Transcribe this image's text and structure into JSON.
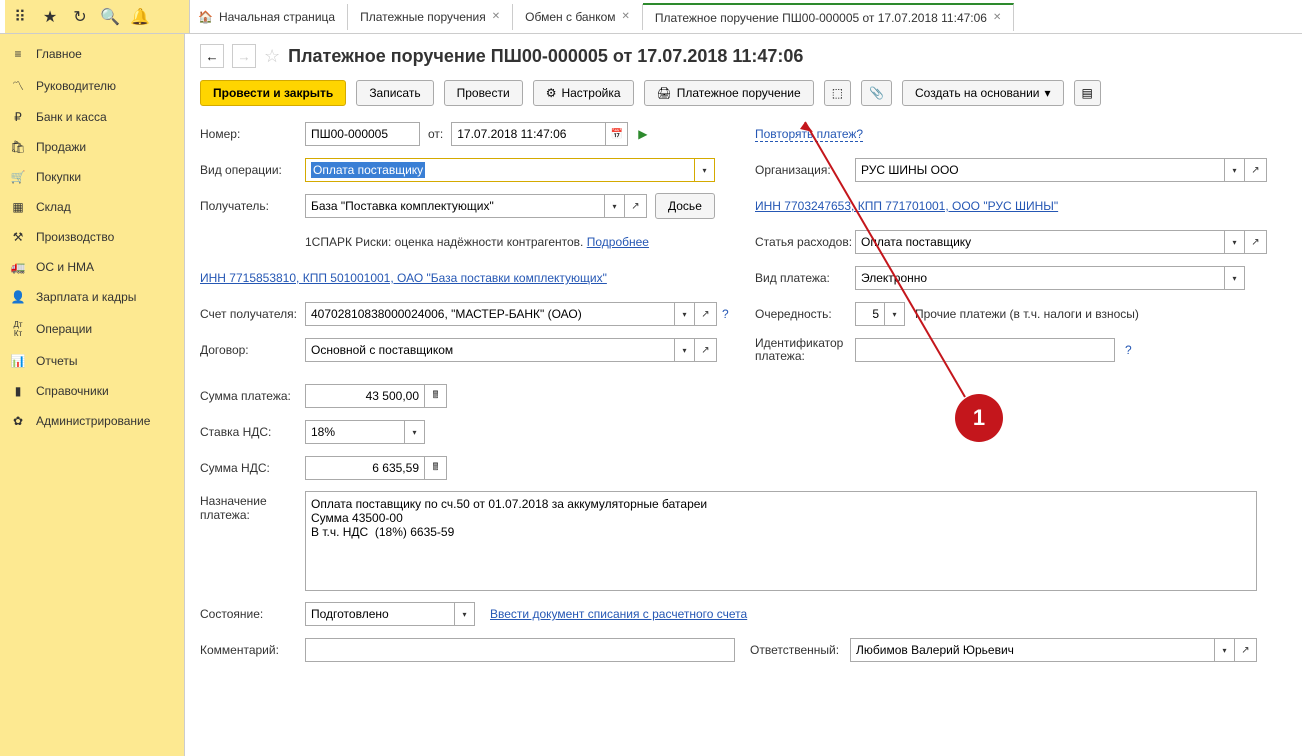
{
  "tabs": {
    "home": "Начальная страница",
    "t1": "Платежные поручения",
    "t2": "Обмен с банком",
    "t3": "Платежное поручение ПШ00-000005 от 17.07.2018 11:47:06"
  },
  "sidebar": {
    "items": [
      {
        "label": "Главное",
        "icon": "≡"
      },
      {
        "label": "Руководителю",
        "icon": "📈"
      },
      {
        "label": "Банк и касса",
        "icon": "₽"
      },
      {
        "label": "Продажи",
        "icon": "🛍"
      },
      {
        "label": "Покупки",
        "icon": "🛒"
      },
      {
        "label": "Склад",
        "icon": "📦"
      },
      {
        "label": "Производство",
        "icon": "🏭"
      },
      {
        "label": "ОС и НМА",
        "icon": "🚚"
      },
      {
        "label": "Зарплата и кадры",
        "icon": "👤"
      },
      {
        "label": "Операции",
        "icon": "Дт/Кт"
      },
      {
        "label": "Отчеты",
        "icon": "📊"
      },
      {
        "label": "Справочники",
        "icon": "📚"
      },
      {
        "label": "Администрирование",
        "icon": "⚙"
      }
    ]
  },
  "title": "Платежное поручение ПШ00-000005 от 17.07.2018 11:47:06",
  "toolbar": {
    "post_close": "Провести и закрыть",
    "write": "Записать",
    "post": "Провести",
    "settings": "Настройка",
    "print": "Платежное поручение",
    "create_based": "Создать на основании"
  },
  "form": {
    "number_label": "Номер:",
    "number": "ПШ00-000005",
    "ot": "от:",
    "date": "17.07.2018 11:47:06",
    "repeat": "Повторять платеж?",
    "operation_label": "Вид операции:",
    "operation": "Оплата поставщику",
    "org_label": "Организация:",
    "org": "РУС ШИНЫ ООО",
    "org_link": "ИНН 7703247653, КПП 771701001, ООО \"РУС ШИНЫ\"",
    "recipient_label": "Получатель:",
    "recipient": "База \"Поставка комплектующих\"",
    "dossier": "Досье",
    "spark": "1СПАРК Риски: оценка надёжности контрагентов.",
    "spark_more": "Подробнее",
    "recipient_link": "ИНН 7715853810, КПП 501001001, ОАО \"База поставки комплектующих\"",
    "expense_label": "Статья расходов:",
    "expense": "Оплата поставщику",
    "payment_type_label": "Вид платежа:",
    "payment_type": "Электронно",
    "account_label": "Счет получателя:",
    "account": "40702810838000024006, \"МАСТЕР-БАНК\" (ОАО)",
    "priority_label": "Очередность:",
    "priority": "5",
    "priority_desc": "Прочие платежи (в т.ч. налоги и взносы)",
    "contract_label": "Договор:",
    "contract": "Основной с поставщиком",
    "identifier_label": "Идентификатор платежа:",
    "sum_label": "Сумма платежа:",
    "sum": "43 500,00",
    "vat_rate_label": "Ставка НДС:",
    "vat_rate": "18%",
    "vat_sum_label": "Сумма НДС:",
    "vat_sum": "6 635,59",
    "purpose_label": "Назначение платежа:",
    "purpose": "Оплата поставщику по сч.50 от 01.07.2018 за аккумуляторные батареи\nСумма 43500-00\nВ т.ч. НДС  (18%) 6635-59",
    "status_label": "Состояние:",
    "status": "Подготовлено",
    "status_link": "Ввести документ списания с расчетного счета",
    "comment_label": "Комментарий:",
    "responsible_label": "Ответственный:",
    "responsible": "Любимов Валерий Юрьевич"
  },
  "annotation": "1"
}
